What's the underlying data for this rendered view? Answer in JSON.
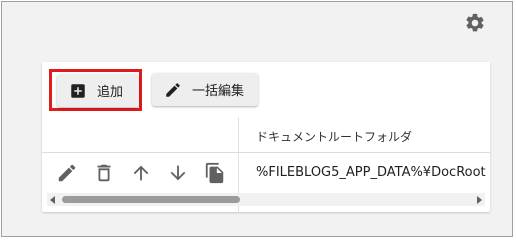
{
  "settings": {
    "icon": "gear-icon"
  },
  "toolbar": {
    "add_label": "追加",
    "add_icon": "plus-box-icon",
    "bulk_edit_label": "一括編集",
    "bulk_edit_icon": "pencil-icon"
  },
  "table": {
    "header": "ドキュメントルートフォルダ",
    "rows": [
      {
        "value": "%FILEBLOG5_APP_DATA%¥DocRoot",
        "actions": [
          "pencil-icon",
          "trash-icon",
          "arrow-up-icon",
          "arrow-down-icon",
          "copy-icon"
        ]
      }
    ]
  },
  "colors": {
    "highlight": "#e01b1b",
    "panel_bg": "#f2f2f2"
  }
}
